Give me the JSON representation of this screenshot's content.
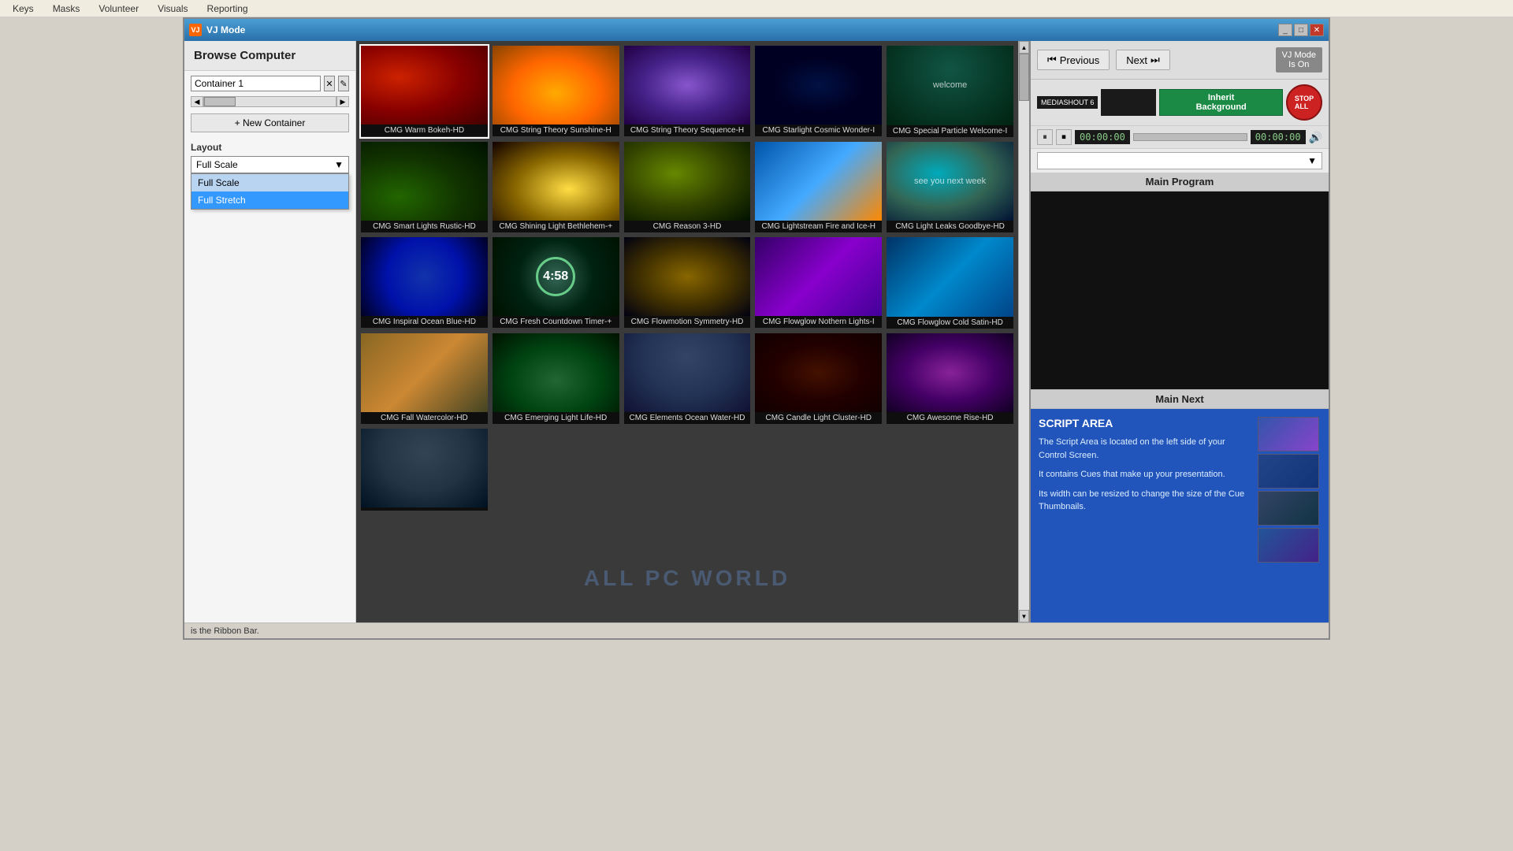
{
  "topNav": {
    "items": [
      "Keys",
      "Masks",
      "Volunteer",
      "Visuals",
      "Reporting"
    ]
  },
  "titleBar": {
    "title": "VJ Mode",
    "icon": "VJ",
    "buttons": [
      "_",
      "□",
      "✕"
    ]
  },
  "sidebar": {
    "browseComputerLabel": "Browse Computer",
    "containerName": "Container 1",
    "newContainerLabel": "+ New Container",
    "layoutLabel": "Layout",
    "layoutSelected": "Full Scale",
    "layoutOptions": [
      "Full Scale",
      "Full Stretch"
    ],
    "layoutHovered": "Full Stretch"
  },
  "gridItems": [
    {
      "label": "CMG Warm Bokeh-HD",
      "thumbClass": "thumb-warm-bokeh"
    },
    {
      "label": "CMG String Theory Sunshine-H",
      "thumbClass": "thumb-string-sunshine"
    },
    {
      "label": "CMG String Theory Sequence-H",
      "thumbClass": "thumb-string-sequence"
    },
    {
      "label": "CMG Starlight Cosmic Wonder-I",
      "thumbClass": "thumb-starlight"
    },
    {
      "label": "CMG Special Particle Welcome-I",
      "thumbClass": "thumb-particle-welcome",
      "text": "welcome"
    },
    {
      "label": "CMG Smart Lights Rustic-HD",
      "thumbClass": "thumb-smart-lights"
    },
    {
      "label": "CMG Shining Light Bethlehem-+",
      "thumbClass": "thumb-shining-light"
    },
    {
      "label": "CMG Reason 3-HD",
      "thumbClass": "thumb-reason"
    },
    {
      "label": "CMG Lightstream Fire and Ice-H",
      "thumbClass": "thumb-lightstream"
    },
    {
      "label": "CMG Light Leaks Goodbye-HD",
      "thumbClass": "thumb-light-leaks",
      "text": "see you next week"
    },
    {
      "label": "CMG Inspiral Ocean Blue-HD",
      "thumbClass": "thumb-inspiral"
    },
    {
      "label": "CMG Fresh Countdown Timer-+",
      "thumbClass": "thumb-countdown",
      "countdown": "4:58"
    },
    {
      "label": "CMG Flowmotion Symmetry-HD",
      "thumbClass": "thumb-flowmotion"
    },
    {
      "label": "CMG Flowglow Nothern Lights-I",
      "thumbClass": "thumb-flowglow-nothern"
    },
    {
      "label": "CMG Flowglow Cold Satin-HD",
      "thumbClass": "thumb-flowglow-cold"
    },
    {
      "label": "CMG Fall Watercolor-HD",
      "thumbClass": "thumb-fall-watercolor"
    },
    {
      "label": "CMG Emerging Light Life-HD",
      "thumbClass": "thumb-emerging-light"
    },
    {
      "label": "CMG Elements Ocean Water-HD",
      "thumbClass": "thumb-elements-ocean"
    },
    {
      "label": "CMG Candle Light Cluster-HD",
      "thumbClass": "thumb-candle-light"
    },
    {
      "label": "CMG Awesome Rise-HD",
      "thumbClass": "thumb-awesome-rise"
    },
    {
      "label": "",
      "thumbClass": "thumb-last"
    }
  ],
  "rightPanel": {
    "prevLabel": "Previous",
    "nextLabel": "Next",
    "vjModeBadge": "VJ Mode\nIs On",
    "mediaLogo": "MEDIASHOUT 6",
    "inheritBgLabel": "Inherit\nBackground",
    "stopAllLabel": "STOP\nALL",
    "timeStart": "00:00:00",
    "timeEnd": "00:00:00",
    "mainProgramLabel": "Main Program",
    "mainNextLabel": "Main Next",
    "scriptAreaTitle": "SCRIPT AREA",
    "scriptAreaText1": "The Script Area is located on the left side of your Control Screen.",
    "scriptAreaText2": "It contains Cues that make up your presentation.",
    "scriptAreaText3": "Its width can be resized to change the size of the Cue Thumbnails."
  },
  "bottomStatus": {
    "text": "is the Ribbon Bar."
  },
  "watermark": "ALL PC WORLD"
}
